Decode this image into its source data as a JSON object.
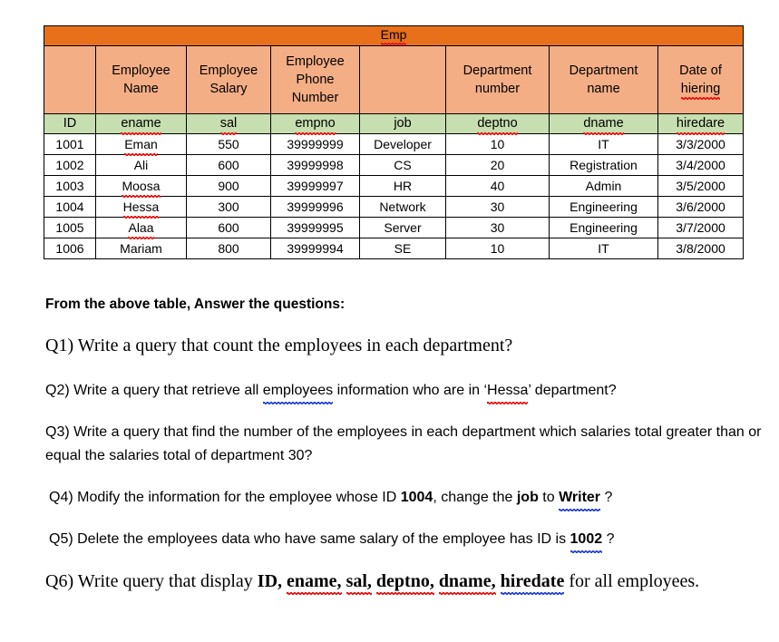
{
  "table": {
    "title": "Emp",
    "group_headers": [
      "",
      "Employee Name",
      "Employee Salary",
      "Employee Phone Number",
      "",
      "Department number",
      "Department name",
      "Date of hiering"
    ],
    "column_headers": [
      "ID",
      "ename",
      "sal",
      "empno",
      "job",
      "deptno",
      "dname",
      "hiredare"
    ],
    "rows": [
      [
        "1001",
        "Eman",
        "550",
        "39999999",
        "Developer",
        "10",
        "IT",
        "3/3/2000"
      ],
      [
        "1002",
        "Ali",
        "600",
        "39999998",
        "CS",
        "20",
        "Registration",
        "3/4/2000"
      ],
      [
        "1003",
        "Moosa",
        "900",
        "39999997",
        "HR",
        "40",
        "Admin",
        "3/5/2000"
      ],
      [
        "1004",
        "Hessa",
        "300",
        "39999996",
        "Network",
        "30",
        "Engineering",
        "3/6/2000"
      ],
      [
        "1005",
        "Alaa",
        "600",
        "39999995",
        "Server",
        "30",
        "Engineering",
        "3/7/2000"
      ],
      [
        "1006",
        "Mariam",
        "800",
        "39999994",
        "SE",
        "10",
        "IT",
        "3/8/2000"
      ]
    ],
    "colors": {
      "title_bar": "#E8701A",
      "group_header": "#F4AE85",
      "column_header": "#C7DFB0",
      "data_row": "#FFFFFF",
      "border": "#000000"
    }
  },
  "questions": {
    "intro": "From the above table, Answer the questions:",
    "q1": "Q1) Write a query that count the employees in each department?",
    "q2": {
      "part1": "Q2) Write a query that retrieve all ",
      "employees": "employees",
      "part2": " information who are in ‘",
      "hessa": "Hessa",
      "part3": "’ department?"
    },
    "q3": "Q3) Write a query that find the number of the employees in each department which salaries total greater than or equal the salaries total of department 30?",
    "q4": {
      "part1": "Q4) Modify the information for the employee whose ID ",
      "id": "1004",
      "part2": ", change the ",
      "job": "job",
      "part3": " to ",
      "writer": "Writer",
      "part4": " ?"
    },
    "q5": {
      "part1": "Q5) Delete the employees data who have same salary of the employee has ID is ",
      "id": "1002",
      "part2": " ?"
    },
    "q6": {
      "part1": "Q6) Write query that display ",
      "id": "ID,",
      "ename": "ename,",
      "sal": "sal,",
      "deptno": "deptno,",
      "dname": "dname,",
      "hiredate": "hiredate",
      "part2": "  for all employees."
    }
  }
}
